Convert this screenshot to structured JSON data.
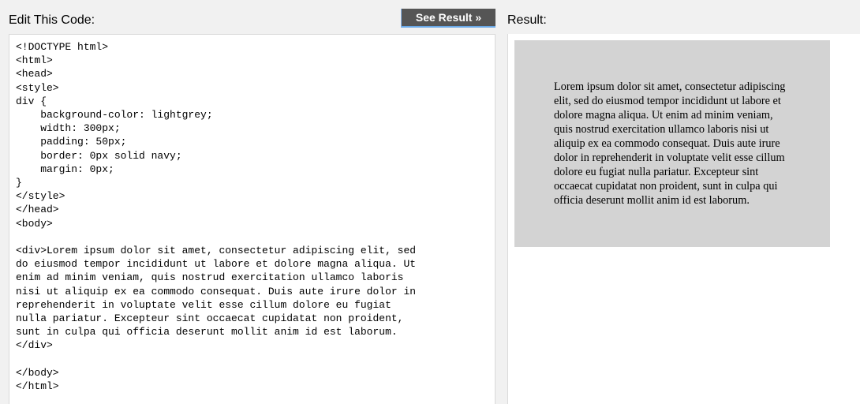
{
  "left_panel": {
    "label": "Edit This Code:"
  },
  "toolbar": {
    "see_result_label": "See Result »"
  },
  "editor": {
    "code": "<!DOCTYPE html>\n<html>\n<head>\n<style>\ndiv {\n    background-color: lightgrey;\n    width: 300px;\n    padding: 50px;\n    border: 0px solid navy;\n    margin: 0px;\n}\n</style>\n</head>\n<body>\n\n<div>Lorem ipsum dolor sit amet, consectetur adipiscing elit, sed\ndo eiusmod tempor incididunt ut labore et dolore magna aliqua. Ut\nenim ad minim veniam, quis nostrud exercitation ullamco laboris\nnisi ut aliquip ex ea commodo consequat. Duis aute irure dolor in\nreprehenderit in voluptate velit esse cillum dolore eu fugiat\nnulla pariatur. Excepteur sint occaecat cupidatat non proident,\nsunt in culpa qui officia deserunt mollit anim id est laborum.\n</div>\n\n</body>\n</html>"
  },
  "right_panel": {
    "label": "Result:",
    "box_text": "Lorem ipsum dolor sit amet, consectetur adipiscing elit, sed do eiusmod tempor incididunt ut labore et dolore magna aliqua. Ut enim ad minim veniam, quis nostrud exercitation ullamco laboris nisi ut aliquip ex ea commodo consequat. Duis aute irure dolor in reprehenderit in voluptate velit esse cillum dolore eu fugiat nulla pariatur. Excepteur sint occaecat cupidatat non proident, sunt in culpa qui officia deserunt mollit anim id est laborum."
  },
  "colors": {
    "page_background": "#f1f1f1",
    "button_background": "#555555",
    "button_accent": "#6aa9e8",
    "result_box_background": "#d3d3d3"
  }
}
